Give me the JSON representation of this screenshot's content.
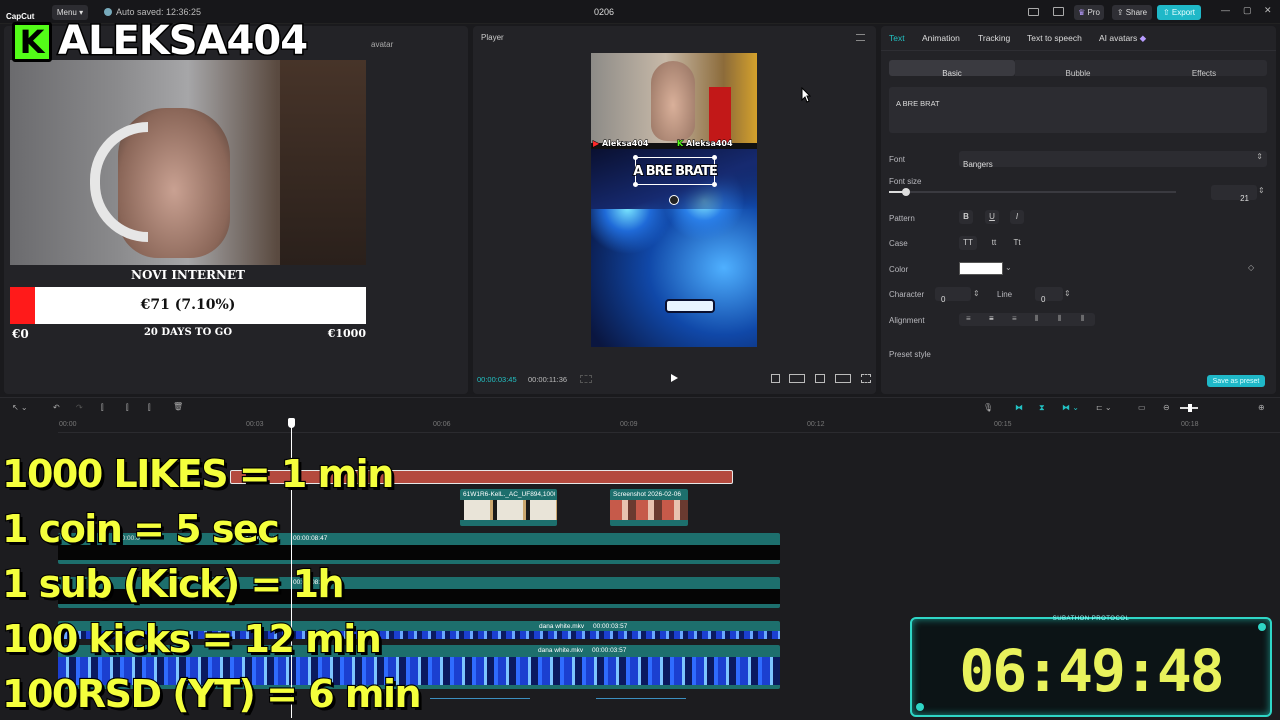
{
  "topbar": {
    "app_name": "CapCut",
    "menu_label": "Menu",
    "autosave": "Auto saved: 12:36:25",
    "project_title": "0206",
    "pro_label": "Pro",
    "share_label": "Share",
    "export_label": "Export"
  },
  "media_panel": {
    "avatar_tab": "avatar"
  },
  "webcam_overlay": {
    "streamer_name": "ALEKSA404",
    "logo_letter": "K",
    "goal_title": "NOVI INTERNET",
    "goal_amount": "€71 (7.10%)",
    "goal_progress": 0.071,
    "goal_min": "€0",
    "goal_days": "20 DAYS TO GO",
    "goal_max": "€1000"
  },
  "player": {
    "title": "Player",
    "caption_text": "A BRE BRATE",
    "current_time": "00:00:03:45",
    "total_time": "00:00:11:36",
    "tag_left": "Aleksa404",
    "tag_right": "Aleksa404"
  },
  "inspector": {
    "tabs": [
      "Text",
      "Animation",
      "Tracking",
      "Text to speech",
      "AI avatars"
    ],
    "subtabs": [
      "Basic",
      "Bubble",
      "Effects"
    ],
    "text_value": "A BRE BRAT",
    "font_label": "Font",
    "font_value": "Bangers",
    "font_size_label": "Font size",
    "font_size_value": "21",
    "font_size_fraction": 0.06,
    "pattern_label": "Pattern",
    "pattern_buttons": [
      "B",
      "U",
      "I"
    ],
    "case_label": "Case",
    "case_buttons": [
      "TT",
      "tt",
      "Tt"
    ],
    "color_label": "Color",
    "text_color": "#ffffff",
    "character_label": "Character",
    "character_value": "0",
    "line_label": "Line",
    "line_value": "0",
    "alignment_label": "Alignment",
    "preset_label": "Preset style",
    "save_preset_label": "Save as preset"
  },
  "timeline": {
    "ruler": [
      "00:00",
      "00:03",
      "00:06",
      "00:09",
      "00:12",
      "00:15",
      "00:18"
    ],
    "clip_image1": "61W1R6-KelL._AC_UF894,1000",
    "clip_image2": "Screenshot 2026-02-06",
    "clip_video1_left": "00:00:0",
    "clip_video1_name": "My presets",
    "clip_video1_dur": "00:00:08:47",
    "clip_video2_dur": "00:00:08:47",
    "clip_dana1_name": "dana white.mkv",
    "clip_dana1_dur": "00:00:03:57",
    "clip_dana2_name": "dana white.mkv",
    "clip_dana2_dur": "00:00:03:57"
  },
  "stream_overlay": {
    "lines": [
      "1000 LIKES = 1 min",
      "1 coin = 5 sec",
      "1 sub (Kick) = 1h",
      "100 kicks = 12 min",
      "100RSD (YT) = 6 min"
    ],
    "timer_title": "SUBATHON PROTOCOL",
    "timer_value": "06:49:48"
  },
  "colors": {
    "accent": "#22c1c3",
    "export": "#1fb8c8",
    "text_track": "#b44a3e",
    "video_track": "#1d6f6d",
    "timer_yellow": "#e8f25c",
    "progress_red": "#ff1a1a"
  }
}
